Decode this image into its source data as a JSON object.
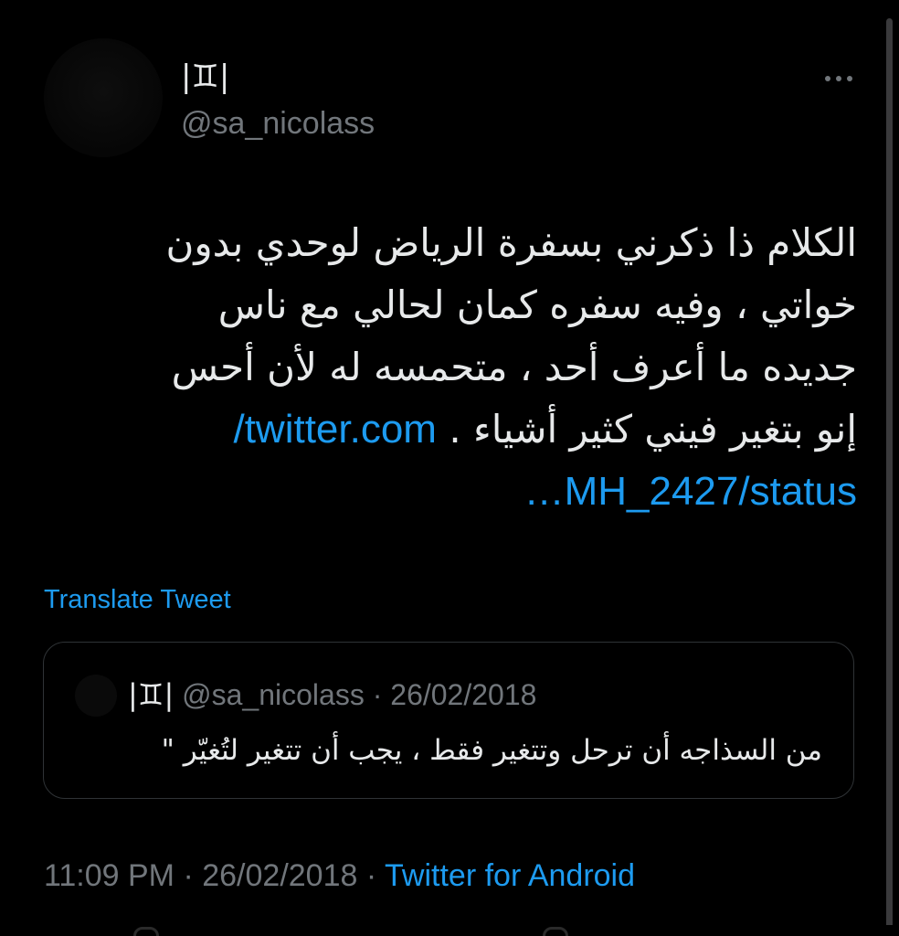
{
  "author": {
    "display_name": "|♊︎|",
    "handle": "@sa_nicolass"
  },
  "tweet": {
    "lines": [
      "الكلام ذا ذكرني بسفرة الرياض لوحدي بدون",
      "خواتي ، وفيه سفره كمان لحالي مع ناس",
      "جديده ما أعرف أحد ، متحمسه له لأن أحس",
      "إنو بتغير فيني كثير أشياء ."
    ],
    "link_line1": "twitter.com/",
    "link_line2": "MH_2427/status…"
  },
  "translate_label": "Translate Tweet",
  "quote": {
    "display_name": "|♊︎|",
    "handle": "@sa_nicolass",
    "separator": " · ",
    "date": "26/02/2018",
    "text": "من السذاجه أن ترحل وتتغير فقط ، يجب أن تتغير لتُغيّر \""
  },
  "meta": {
    "time": "11:09 PM",
    "date": "26/02/2018",
    "separator": " · ",
    "source": "Twitter for Android"
  },
  "icons": {
    "more": "more-horizontal-icon"
  },
  "colors": {
    "background": "#000000",
    "text": "#e7e9ea",
    "secondary": "#71767b",
    "link": "#1d9bf0",
    "border": "#2f3336"
  }
}
